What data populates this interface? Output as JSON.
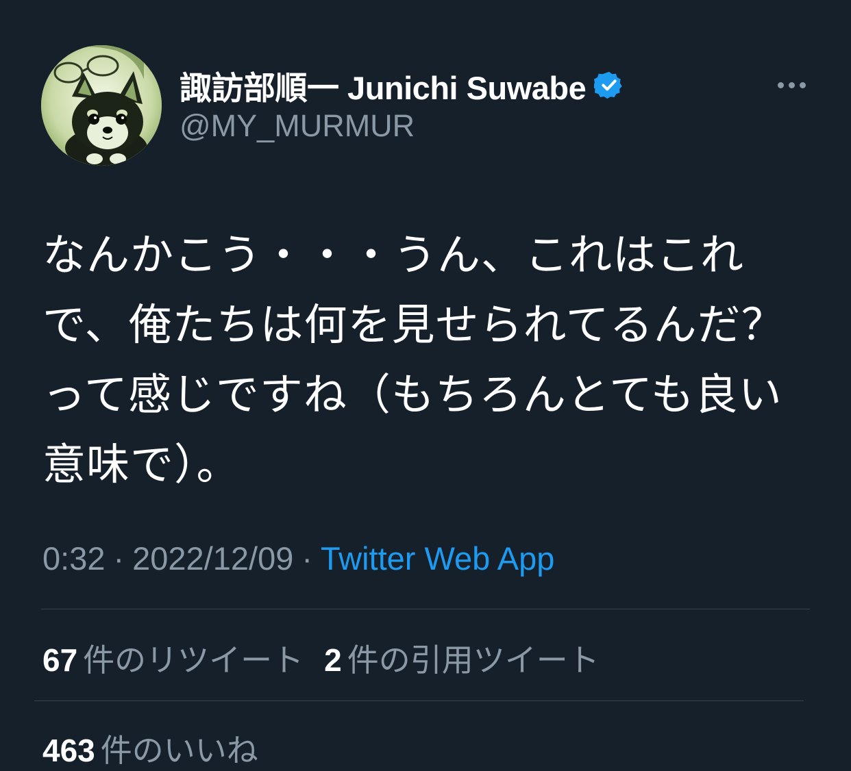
{
  "author": {
    "name": "諏訪部順一 Junichi Suwabe",
    "handle": "@MY_MURMUR",
    "verified": true,
    "verified_color": "#1d9bf0",
    "avatar_icon": "dog-avatar"
  },
  "tweet": {
    "text": "なんかこう・・・うん、これはこれで、俺たちは何を見せられてるんだ？って感じですね（もちろんとても良い意味で）。",
    "time": "0:32",
    "separator": "·",
    "date": "2022/12/09",
    "source": "Twitter Web App"
  },
  "stats": {
    "retweets_count": "67",
    "retweets_label": "件のリツイート",
    "quotes_count": "2",
    "quotes_label": "件の引用ツイート",
    "likes_count": "463",
    "likes_label": "件のいいね"
  },
  "colors": {
    "background": "#15202b",
    "text_primary": "#ffffff",
    "text_secondary": "#8b98a5",
    "link": "#1d9bf0",
    "divider": "#38444d"
  }
}
